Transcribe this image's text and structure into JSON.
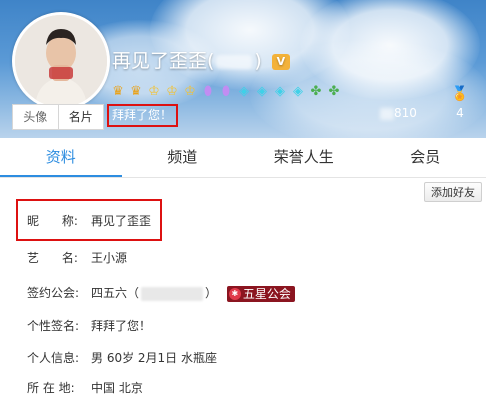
{
  "header": {
    "nickname": "再见了歪歪(",
    "nickname_suffix": ")",
    "vip_label": "V",
    "signature": "拜拜了您！",
    "fans_count_visible": "810",
    "medal_count": "4",
    "avatar_tabs": [
      "头像",
      "名片"
    ]
  },
  "tabs": [
    "资料",
    "频道",
    "荣誉人生",
    "会员"
  ],
  "add_friend_label": "添加好友",
  "profile": {
    "nickname": {
      "label": "昵      称:",
      "value": "再见了歪歪"
    },
    "art_name": {
      "label": "艺      名:",
      "value": "王小源"
    },
    "guild": {
      "label": "签约公会:",
      "value": "四五六（",
      "suffix": "）",
      "badge": "五星公会"
    },
    "signature": {
      "label": "个性签名:",
      "value": "拜拜了您！"
    },
    "personal": {
      "label": "个人信息:",
      "value": "男    60岁    2月1日    水瓶座"
    },
    "location": {
      "label": "所 在 地:",
      "value": "中国    北京"
    }
  },
  "colors": {
    "accent": "#2d8de0",
    "highlight_border": "#dd1111",
    "guild_badge": "#8b1520"
  },
  "icons": [
    "crown-icon",
    "crown-icon",
    "crown-icon",
    "crown-icon",
    "crown-icon",
    "gem-icon",
    "gem-icon",
    "diamond-icon",
    "diamond-icon",
    "diamond-icon",
    "diamond-icon",
    "leaf-icon",
    "leaf-icon",
    "medal-icon"
  ]
}
